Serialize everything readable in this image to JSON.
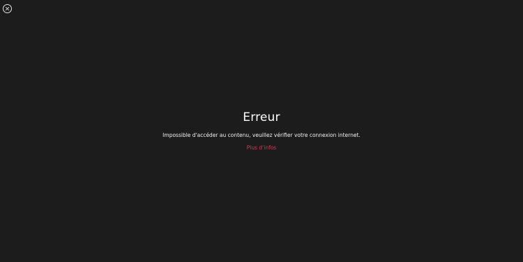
{
  "error": {
    "title": "Erreur",
    "message": "Impossible d'accéder au contenu, veuillez vérifier votre connexion internet.",
    "more_info_label": "Plus d'infos"
  },
  "controls": {
    "close_icon": "close-circle-icon"
  },
  "colors": {
    "background": "#1c1c1c",
    "text": "#ffffff",
    "link": "#e0364f"
  }
}
